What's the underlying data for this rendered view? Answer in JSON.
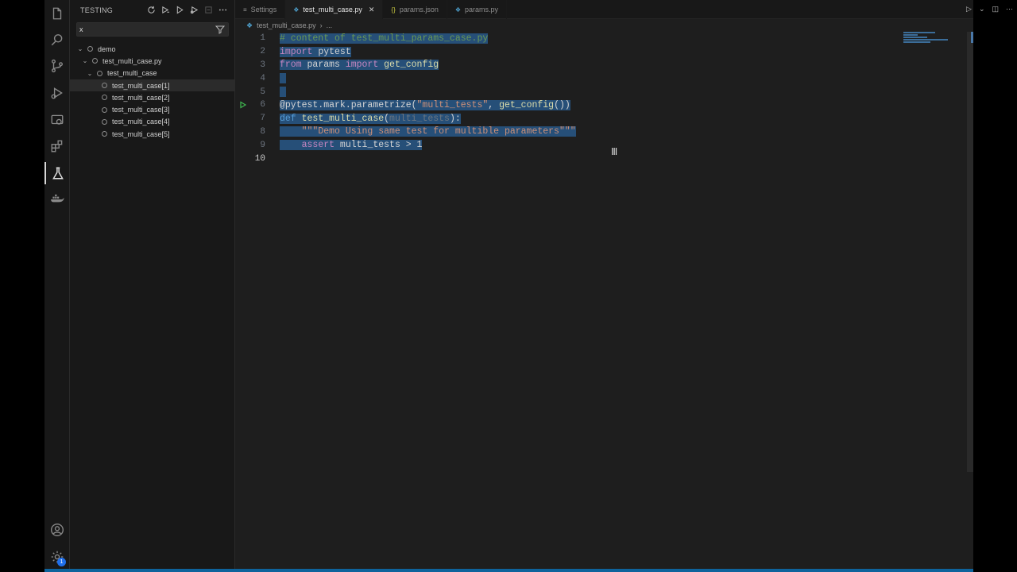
{
  "sidebar": {
    "title": "TESTING",
    "filter_value": "x",
    "tree": [
      {
        "label": "demo",
        "level": 0
      },
      {
        "label": "test_multi_case.py",
        "level": 1
      },
      {
        "label": "test_multi_case",
        "level": 2
      },
      {
        "label": "test_multi_case[1]",
        "level": 3
      },
      {
        "label": "test_multi_case[2]",
        "level": 3
      },
      {
        "label": "test_multi_case[3]",
        "level": 3
      },
      {
        "label": "test_multi_case[4]",
        "level": 3
      },
      {
        "label": "test_multi_case[5]",
        "level": 3
      }
    ]
  },
  "tabs": [
    {
      "label": "Settings",
      "icon": "settings-icon"
    },
    {
      "label": "test_multi_case.py",
      "icon": "python-icon"
    },
    {
      "label": "params.json",
      "icon": "json-icon"
    },
    {
      "label": "params.py",
      "icon": "python-icon"
    }
  ],
  "breadcrumb": {
    "file": "test_multi_case.py",
    "more": "..."
  },
  "code": {
    "line_numbers": [
      "1",
      "2",
      "3",
      "4",
      "5",
      "6",
      "7",
      "8",
      "9",
      "10"
    ],
    "l1": "# content of test_multi_params_case.py",
    "l2_kw": "import",
    "l2_rest": " pytest",
    "l3_kw1": "from",
    "l3_mid": " params ",
    "l3_kw2": "import",
    "l3_rest": " get_config",
    "l6_a": "@pytest.mark.parametrize(",
    "l6_s": "\"multi_tests\"",
    "l6_b": ", ",
    "l6_fn": "get_config",
    "l6_c": "())",
    "l7_kw": "def",
    "l7_fn": " test_multi_case",
    "l7_a": "(",
    "l7_p": "multi_tests",
    "l7_b": "):",
    "l8_indent": "    ",
    "l8_s": "\"\"\"Demo Using same test for multible parameters\"\"\"",
    "l9_indent": "    ",
    "l9_kw": "assert",
    "l9_rest": " multi_tests > 1"
  },
  "activity_badge": "1",
  "colors": {
    "accent": "#0e639c",
    "selection": "#264f78",
    "run": "#3fb950"
  }
}
